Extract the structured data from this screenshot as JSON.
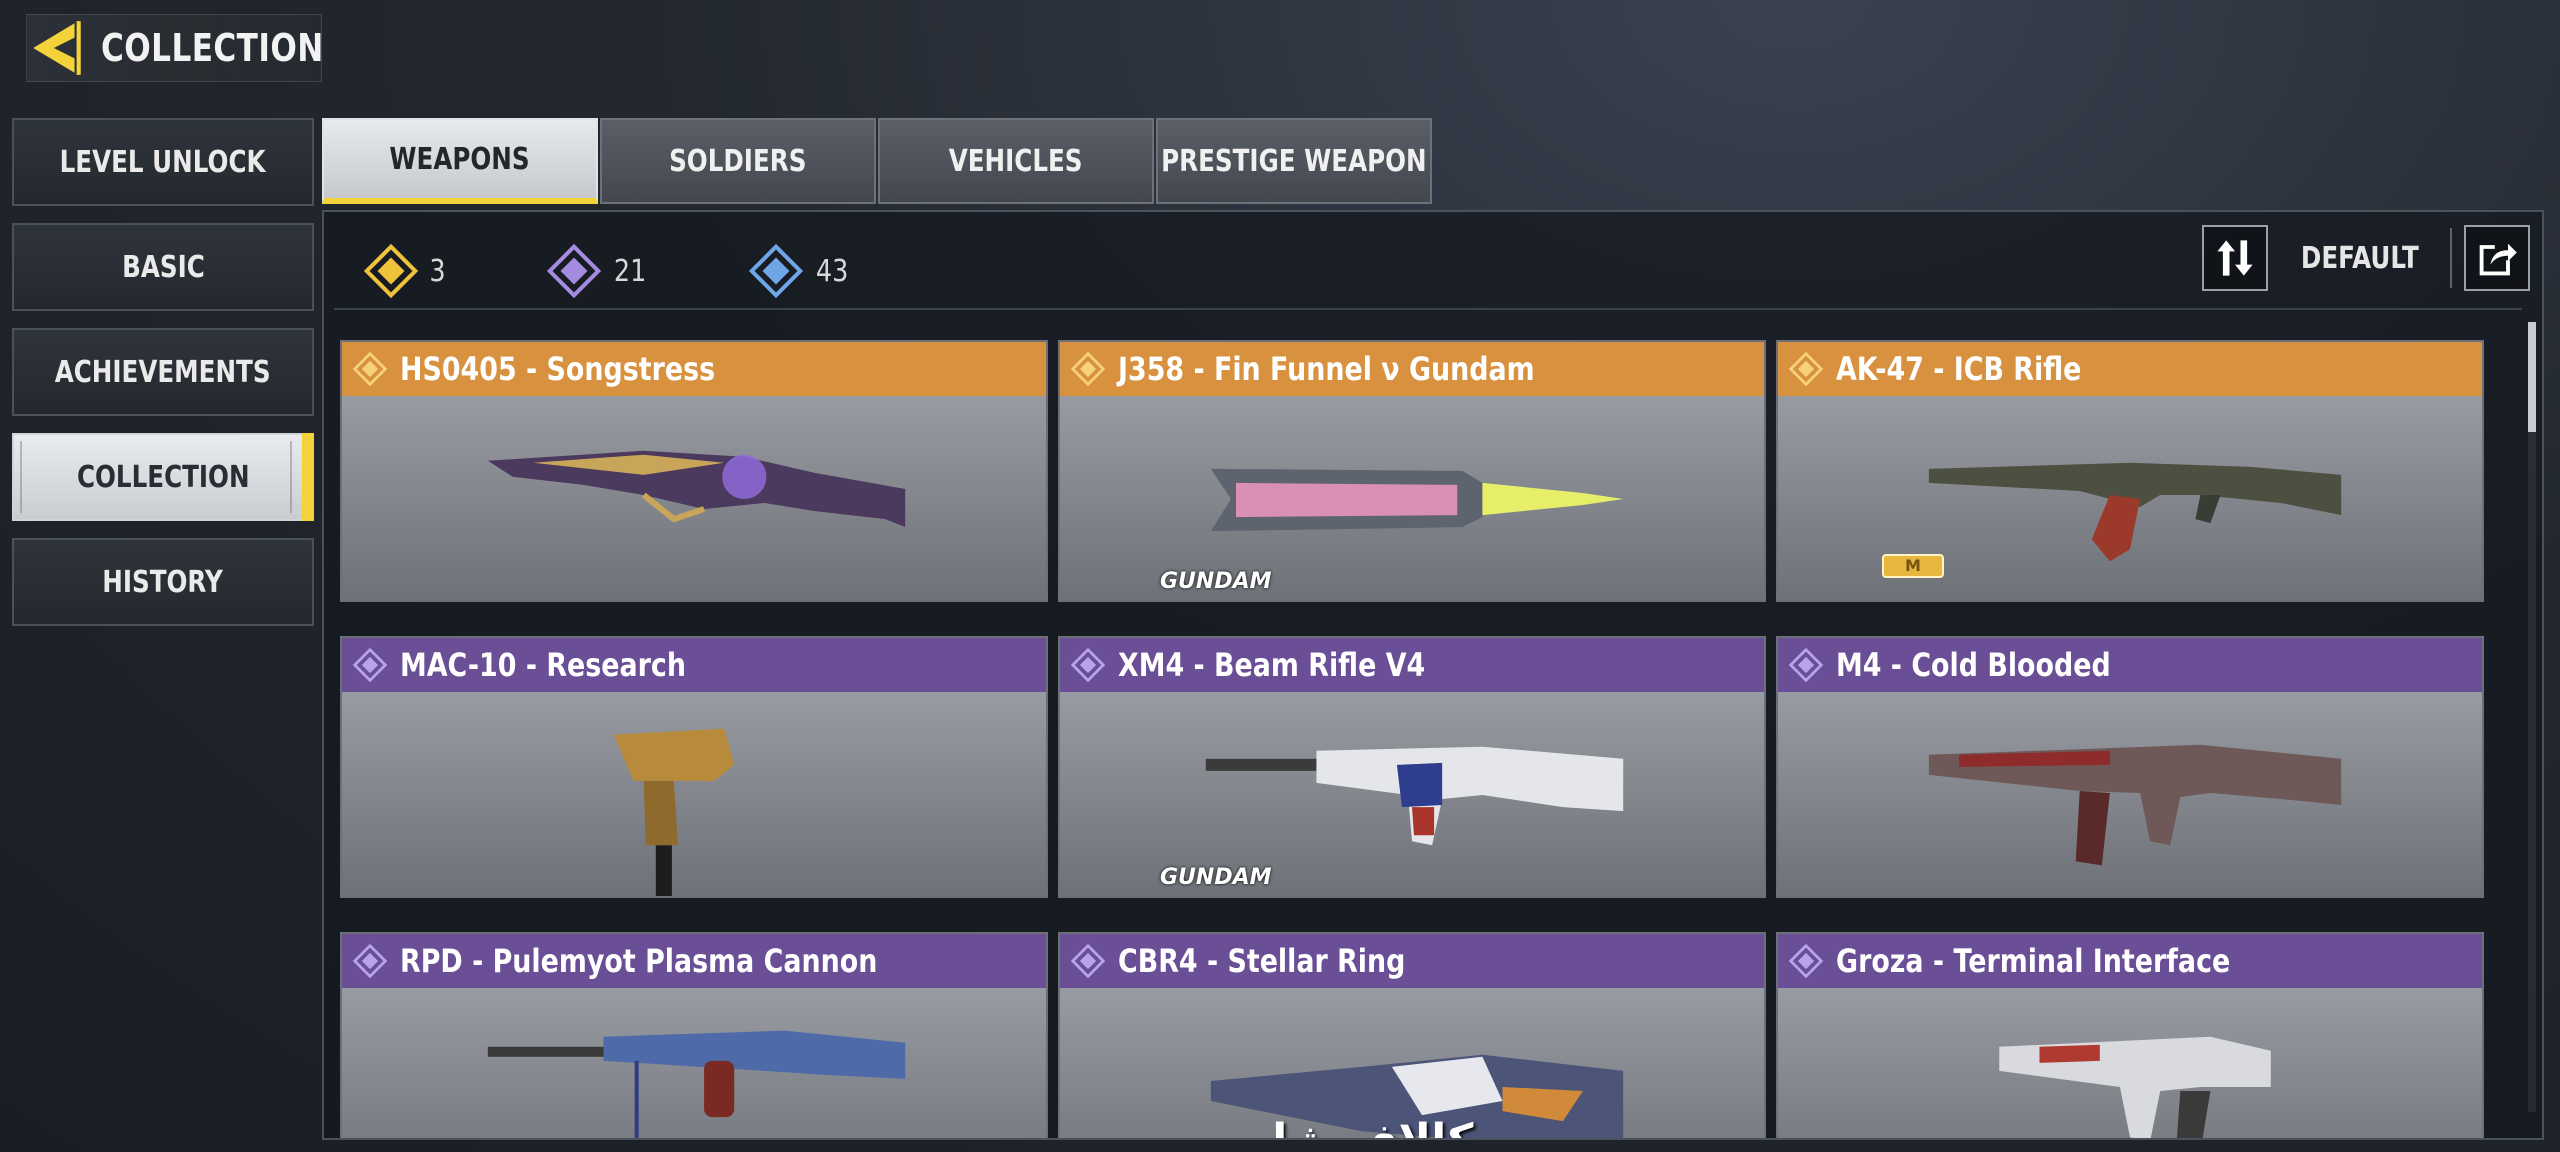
{
  "header": {
    "title": "COLLECTION"
  },
  "sidebar": {
    "items": [
      {
        "label": "LEVEL UNLOCK"
      },
      {
        "label": "BASIC"
      },
      {
        "label": "ACHIEVEMENTS"
      },
      {
        "label": "COLLECTION"
      },
      {
        "label": "HISTORY"
      }
    ]
  },
  "tabs": [
    {
      "label": "WEAPONS"
    },
    {
      "label": "SOLDIERS"
    },
    {
      "label": "VEHICLES"
    },
    {
      "label": "PRESTIGE WEAPON"
    }
  ],
  "counts": {
    "legendary": "3",
    "epic": "21",
    "rare": "43",
    "colors": {
      "legendary": "#f0c33c",
      "epic": "#a58be0",
      "rare": "#6fa6e8"
    }
  },
  "sort": {
    "label": "DEFAULT"
  },
  "cards": [
    {
      "name": "HS0405 - Songstress",
      "rarity": "gold"
    },
    {
      "name": "J358 - Fin Funnel ν Gundam",
      "rarity": "gold",
      "brand": "GUNDAM"
    },
    {
      "name": "AK-47 - ICB Rifle",
      "rarity": "gold",
      "mark": "M"
    },
    {
      "name": "MAC-10 - Research",
      "rarity": "purple"
    },
    {
      "name": "XM4 - Beam Rifle V4",
      "rarity": "purple",
      "brand": "GUNDAM"
    },
    {
      "name": "M4 - Cold Blooded",
      "rarity": "purple"
    },
    {
      "name": "RPD - Pulemyot Plasma Cannon",
      "rarity": "purple"
    },
    {
      "name": "CBR4 - Stellar Ring",
      "rarity": "purple",
      "watermark": "کالاف شاپ"
    },
    {
      "name": "Groza - Terminal Interface",
      "rarity": "purple"
    }
  ],
  "colors": {
    "accent": "#f2d43a",
    "gold_header": "#d8913f",
    "purple_header": "#6a4f97"
  }
}
